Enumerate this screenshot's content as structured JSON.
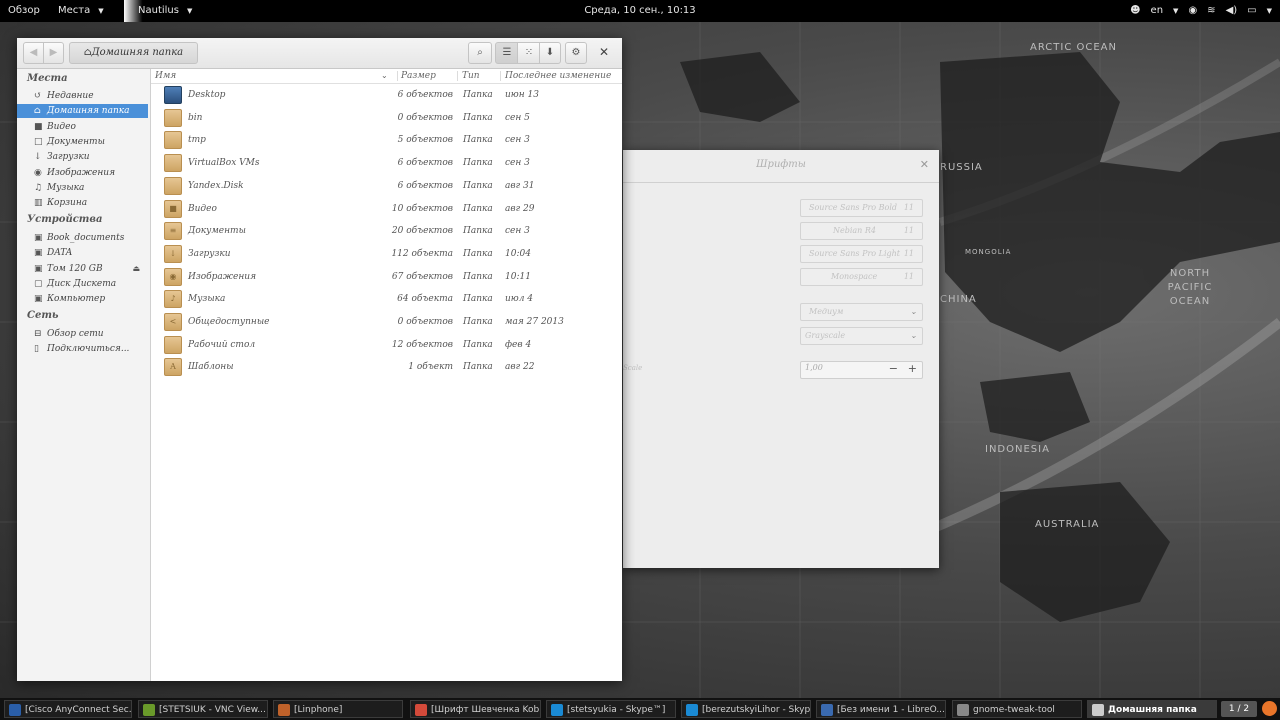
{
  "topbar": {
    "activities": "Обзор",
    "places": "Места",
    "app_menu": "Nautilus",
    "clock": "Среда, 10 сен., 10:13",
    "keyboard_layout": "en"
  },
  "wallpaper_labels": {
    "arctic": "ARCTIC OCEAN",
    "russia": "RUSSIA",
    "mongolia": "MONGOLIA",
    "china": "CHINA",
    "north_pacific": "NORTH PACIFIC OCEAN",
    "indonesia": "INDONESIA",
    "australia": "AUSTRALIA"
  },
  "fonts_window": {
    "title": "Шрифты",
    "fonts": [
      {
        "name": "Source Sans Pro Bold",
        "size": "11"
      },
      {
        "name": "Nebian R4",
        "size": "11"
      },
      {
        "name": "Source Sans Pro Light",
        "size": "11"
      },
      {
        "name": "Monospace",
        "size": "11"
      }
    ],
    "hinting": "Медиум",
    "antialiasing": "Grayscale",
    "scale_label": "Scale",
    "scale_value": "1,00"
  },
  "nautilus": {
    "path_button": "Домашняя папка",
    "sidebar": {
      "places_header": "Места",
      "places": [
        {
          "label": "Недавние",
          "icon": "↺"
        },
        {
          "label": "Домашняя папка",
          "icon": "⌂",
          "active": true
        },
        {
          "label": "Видео",
          "icon": "■"
        },
        {
          "label": "Документы",
          "icon": "□"
        },
        {
          "label": "Загрузки",
          "icon": "↓"
        },
        {
          "label": "Изображения",
          "icon": "◉"
        },
        {
          "label": "Музыка",
          "icon": "♫"
        },
        {
          "label": "Корзина",
          "icon": "▥"
        }
      ],
      "devices_header": "Устройства",
      "devices": [
        {
          "label": "Book_documents",
          "icon": "▣"
        },
        {
          "label": "DATA",
          "icon": "▣"
        },
        {
          "label": "Том 120 GB",
          "icon": "▣",
          "eject": true
        },
        {
          "label": "Диск Дискета",
          "icon": "▢"
        },
        {
          "label": "Компьютер",
          "icon": "▣"
        }
      ],
      "network_header": "Сеть",
      "network": [
        {
          "label": "Обзор сети",
          "icon": "⊟"
        },
        {
          "label": "Подключиться...",
          "icon": "▯"
        }
      ]
    },
    "columns": {
      "name": "Имя",
      "size": "Размер",
      "type": "Тип",
      "modified": "Последнее изменение"
    },
    "files": [
      {
        "name": "Desktop",
        "size": "6 объектов",
        "type": "Папка",
        "date": "июн 13",
        "icon": "desk"
      },
      {
        "name": "bin",
        "size": "0 объектов",
        "type": "Папка",
        "date": "сен 5",
        "icon": ""
      },
      {
        "name": "tmp",
        "size": "5 объектов",
        "type": "Папка",
        "date": "сен 3",
        "icon": ""
      },
      {
        "name": "VirtualBox VMs",
        "size": "6 объектов",
        "type": "Папка",
        "date": "сен 3",
        "icon": ""
      },
      {
        "name": "Yandex.Disk",
        "size": "6 объектов",
        "type": "Папка",
        "date": "авг 31",
        "icon": ""
      },
      {
        "name": "Видео",
        "size": "10 объектов",
        "type": "Папка",
        "date": "авг 29",
        "icon": "■"
      },
      {
        "name": "Документы",
        "size": "20 объектов",
        "type": "Папка",
        "date": "сен 3",
        "icon": "≡"
      },
      {
        "name": "Загрузки",
        "size": "112 объекта",
        "type": "Папка",
        "date": "10:04",
        "icon": "↓"
      },
      {
        "name": "Изображения",
        "size": "67 объектов",
        "type": "Папка",
        "date": "10:11",
        "icon": "◉"
      },
      {
        "name": "Музыка",
        "size": "64 объекта",
        "type": "Папка",
        "date": "июл 4",
        "icon": "♪"
      },
      {
        "name": "Общедоступные",
        "size": "0 объектов",
        "type": "Папка",
        "date": "мая 27 2013",
        "icon": "<"
      },
      {
        "name": "Рабочий стол",
        "size": "12 объектов",
        "type": "Папка",
        "date": "фев 4",
        "icon": ""
      },
      {
        "name": "Шаблоны",
        "size": "1 объект",
        "type": "Папка",
        "date": "авг 22",
        "icon": "A"
      }
    ]
  },
  "taskbar": {
    "tasks": [
      {
        "label": "[Cisco AnyConnect Sec...",
        "color": "#2a5ea8"
      },
      {
        "label": "[STETSIUK - VNC View...",
        "color": "#6a9a2a"
      },
      {
        "label": "[Linphone]",
        "color": "#c0622a"
      },
      {
        "label": "[Шрифт Шевченка Kob...",
        "color": "#d44a3a"
      },
      {
        "label": "[stetsyukia - Skype™]",
        "color": "#1a8ad4"
      },
      {
        "label": "[berezutskyiLihor - Skyp...",
        "color": "#1a8ad4"
      },
      {
        "label": "[Без имени 1 - LibreO...",
        "color": "#3a6ab0"
      },
      {
        "label": "gnome-tweak-tool",
        "color": "#888888"
      },
      {
        "label": "Домашняя папка",
        "color": "#cccccc",
        "active": true
      }
    ],
    "pager": "1 / 2"
  }
}
